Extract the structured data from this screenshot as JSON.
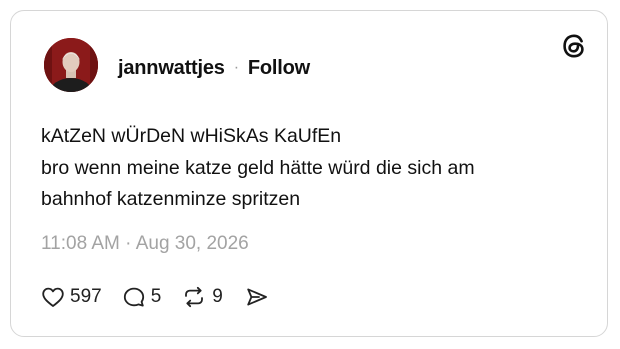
{
  "post": {
    "username": "jannwattjes",
    "separator": "·",
    "follow_label": "Follow",
    "text_lines": [
      "kAtZeN wÜrDeN wHiSkAs KaUfEn",
      "bro wenn meine katze geld hätte würd die sich am",
      "bahnhof katzenminze spritzen"
    ],
    "timestamp": "11:08 AM · Aug 30, 2026"
  },
  "actions": {
    "likes": "597",
    "replies": "5",
    "reposts": "9"
  },
  "icons": {
    "logo": "threads-logo-icon",
    "like": "heart-icon",
    "reply": "comment-bubble-icon",
    "repost": "repost-arrows-icon",
    "share": "send-icon"
  },
  "colors": {
    "text": "#111111",
    "muted": "#a3a3a3",
    "border": "#d6d6d6",
    "avatar_bg": "#8e1d1d"
  }
}
